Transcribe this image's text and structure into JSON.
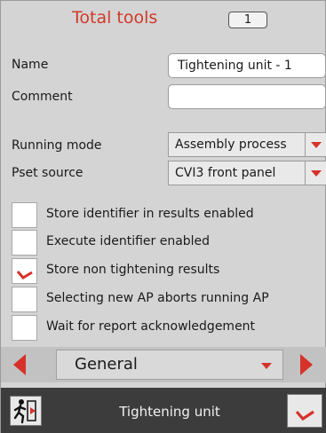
{
  "header": {
    "title": "Total tools",
    "count": "1"
  },
  "fields": {
    "name_label": "Name",
    "name_value": "Tightening unit - 1",
    "comment_label": "Comment",
    "comment_value": ""
  },
  "selects": {
    "running_mode_label": "Running mode",
    "running_mode_value": "Assembly process",
    "pset_source_label": "Pset source",
    "pset_source_value": "CVI3 front panel"
  },
  "options": [
    {
      "label": "Store identifier in results enabled",
      "checked": false
    },
    {
      "label": "Execute identifier enabled",
      "checked": false
    },
    {
      "label": "Store non tightening results",
      "checked": true
    },
    {
      "label": "Selecting new AP aborts running AP",
      "checked": false
    },
    {
      "label": "Wait for report acknowledgement",
      "checked": false
    }
  ],
  "tab_nav": {
    "current": "General"
  },
  "footer": {
    "title": "Tightening unit",
    "exit_icon": "exit-door-icon",
    "confirm_icon": "checkmark-icon"
  },
  "colors": {
    "accent": "#d6322a",
    "background": "#d4d4d4",
    "footer": "#3c3c3c"
  }
}
